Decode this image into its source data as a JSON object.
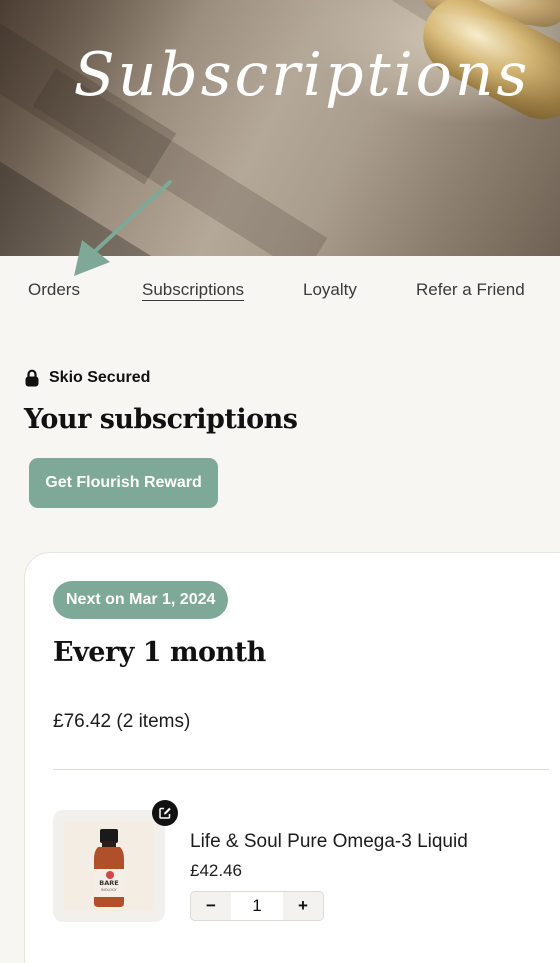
{
  "hero": {
    "title": "Subscriptions"
  },
  "nav": {
    "items": [
      {
        "label": "Orders",
        "active": false
      },
      {
        "label": "Subscriptions",
        "active": true
      },
      {
        "label": "Loyalty",
        "active": false
      },
      {
        "label": "Refer a Friend",
        "active": false
      }
    ]
  },
  "secured_label": "Skio Secured",
  "section_title": "Your subscriptions",
  "reward_button_label": "Get Flourish Reward",
  "subscription": {
    "next_label": "Next on Mar 1, 2024",
    "frequency": "Every 1 month",
    "total": "£76.42 (2 items)",
    "product": {
      "name": "Life & Soul Pure Omega-3 Liquid",
      "price": "£42.46",
      "quantity": "1",
      "decrement_label": "−",
      "increment_label": "+",
      "brand_logo_text": "BARE BIOLOGY"
    }
  },
  "colors": {
    "accent": "#7ea897",
    "arrow": "#7ea897",
    "background": "#f7f6f2"
  },
  "icons": {
    "secure": "lock-icon",
    "edit": "edit-icon",
    "pointer": "arrow-icon"
  }
}
